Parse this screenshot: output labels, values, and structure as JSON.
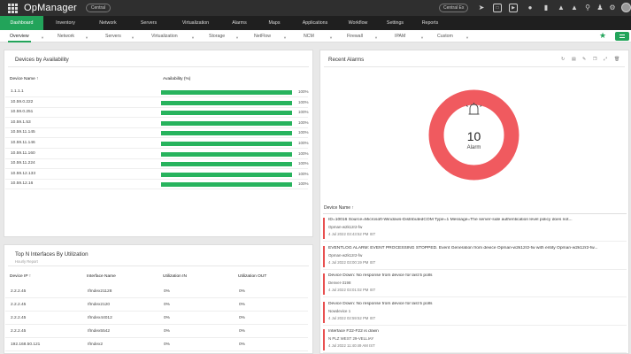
{
  "app": {
    "title": "OpManager",
    "pill": "Central",
    "pill_right": "Central Ex"
  },
  "topbar_icons": [
    "rocket-icon",
    "monitor-icon",
    "video-icon",
    "tag-icon",
    "battery-icon",
    "bell-icon",
    "bell-icon",
    "search-icon",
    "person-icon",
    "gear-icon"
  ],
  "main_nav": [
    "Dashboard",
    "Inventory",
    "Network",
    "Servers",
    "Virtualization",
    "Alarms",
    "Maps",
    "Applications",
    "Workflow",
    "Settings",
    "Reports"
  ],
  "sub_nav": [
    "Overview",
    "Network",
    "Servers",
    "Virtualization",
    "Storage",
    "NetFlow",
    "NCM",
    "Firewall",
    "IPAM",
    "Custom"
  ],
  "availability": {
    "title": "Devices by Availability",
    "col_name": "Device Name ↑",
    "col_avail": "Availability (%)",
    "rows": [
      {
        "name": "1.1.1.1",
        "value": 100,
        "label": "100%"
      },
      {
        "name": "10.59.0.222",
        "value": 100,
        "label": "100%"
      },
      {
        "name": "10.59.0.251",
        "value": 100,
        "label": "100%"
      },
      {
        "name": "10.59.1.53",
        "value": 100,
        "label": "100%"
      },
      {
        "name": "10.59.11.145",
        "value": 100,
        "label": "100%"
      },
      {
        "name": "10.59.11.146",
        "value": 100,
        "label": "100%"
      },
      {
        "name": "10.59.11.160",
        "value": 100,
        "label": "100%"
      },
      {
        "name": "10.59.11.224",
        "value": 100,
        "label": "100%"
      },
      {
        "name": "10.59.12.133",
        "value": 100,
        "label": "100%"
      },
      {
        "name": "10.59.12.16",
        "value": 100,
        "label": "100%"
      }
    ]
  },
  "interfaces": {
    "title": "Top N Interfaces By Utilization",
    "subtitle": "Hourly Report",
    "columns": [
      "Device IP ↑",
      "Interface Name",
      "Utilization IN",
      "Utilization OUT"
    ],
    "rows": [
      [
        "2.2.2.45",
        "IfIndex21128",
        "0%",
        "0%"
      ],
      [
        "2.2.2.45",
        "IfIndex2120",
        "0%",
        "0%"
      ],
      [
        "2.2.2.45",
        "IfIndex44012",
        "0%",
        "0%"
      ],
      [
        "2.2.2.45",
        "IfIndex5542",
        "0%",
        "0%"
      ],
      [
        "192.168.50.121",
        "IfIndex2",
        "0%",
        "0%"
      ]
    ]
  },
  "alarms": {
    "title": "Recent Alarms",
    "count": "10",
    "count_label": "Alarm",
    "donut_color": "#f05a5f",
    "list_header": "Device Name ↑",
    "items": [
      {
        "message": "ID=10016 Source=Microsoft-Windows-DistributedCOM Type=1 Message=The server-side authentication level policy does not...",
        "source": "Opman-w2k12r2-fw",
        "time": "4 Jul 2022 03:43:52 PM IST"
      },
      {
        "message": "EVENTLOG ALARM: EVENT PROCESSING STOPPED. Event Generation from device Opman-w2k12r2-fw with entity Opman-w2k12r2-fw...",
        "source": "Opman-w2k12r2-fw",
        "time": "4 Jul 2022 03:00:19 PM IST"
      },
      {
        "message": "Device Down: No response from device for last 5 polls",
        "source": "Denver-3198",
        "time": "4 Jul 2022 03:01:02 PM IST"
      },
      {
        "message": "Device Down: No response from device for last 5 polls",
        "source": "Nowdevice 1",
        "time": "4 Jul 2022 02:59:52 PM IST"
      },
      {
        "message": "Interface F22-F22 is down",
        "source": "N PLZ WEST 29-VELLIAY",
        "time": "4 Jul 2022 11:40:49 AM IST"
      }
    ]
  }
}
